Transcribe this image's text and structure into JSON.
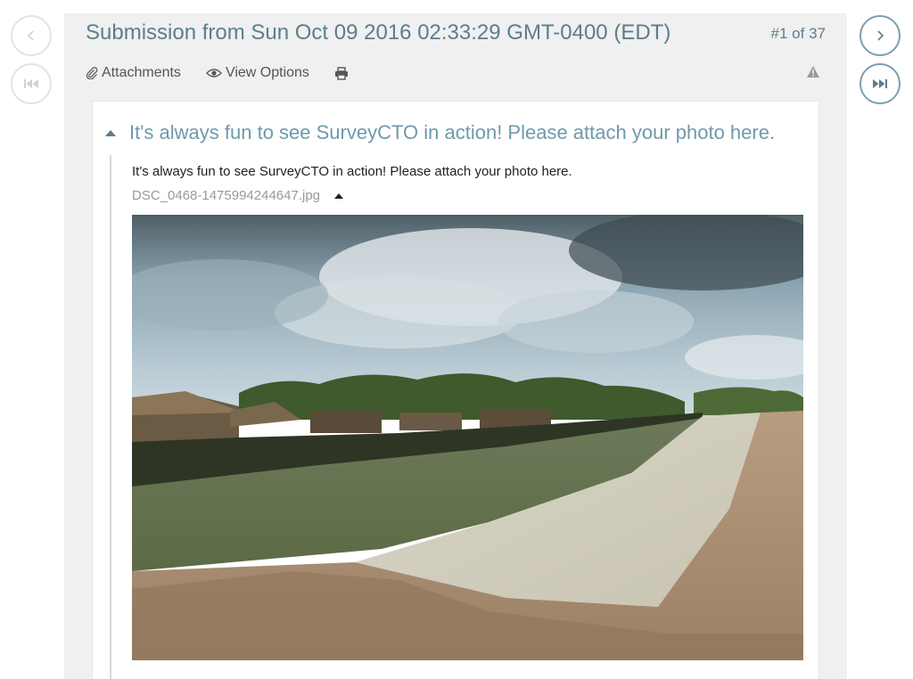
{
  "nav": {
    "prev_icon": "chevron-left-icon",
    "first_icon": "skip-first-icon",
    "next_icon": "chevron-right-icon",
    "last_icon": "skip-last-icon"
  },
  "header": {
    "title": "Submission from Sun Oct 09 2016 02:33:29 GMT-0400 (EDT)",
    "counter": "#1 of 37"
  },
  "toolbar": {
    "attachments_label": "Attachments",
    "attachments_icon": "paperclip-icon",
    "view_options_label": "View Options",
    "view_options_icon": "eye-icon",
    "print_icon": "printer-icon",
    "warning_icon": "warning-icon"
  },
  "question": {
    "title": "It's always fun to see SurveyCTO in action! Please attach your photo here.",
    "label": "It's always fun to see SurveyCTO in action! Please attach your photo here.",
    "file_name": "DSC_0468-1475994244647.jpg"
  },
  "colors": {
    "accent": "#5d7d8d",
    "question_title": "#6f99ad",
    "panel_bg": "#f0f0f0"
  }
}
